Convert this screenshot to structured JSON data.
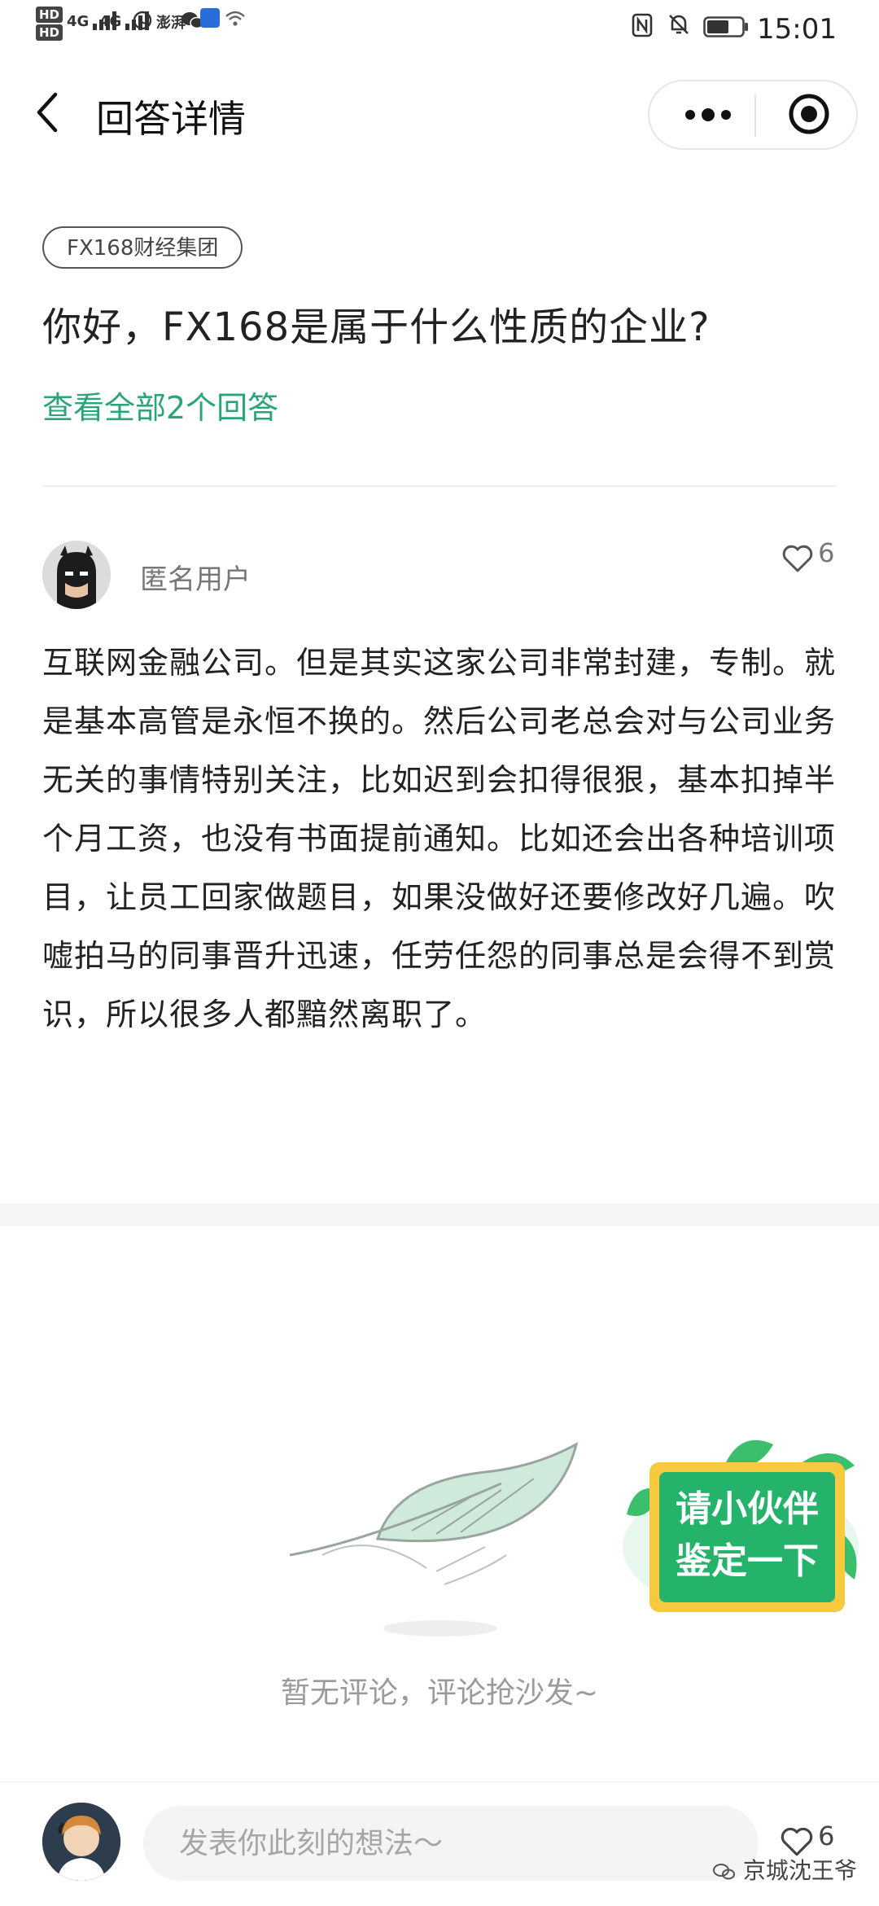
{
  "status_bar": {
    "hd1": "HD",
    "hd2": "HD",
    "sim1": "4G",
    "sim2": "4G",
    "app_icon_1": "澎湃",
    "time": "15:01",
    "icons": [
      "whatsapp-icon",
      "wechat-icon",
      "app-icon",
      "wifi-icon",
      "nfc-icon",
      "mute-icon",
      "battery-icon"
    ]
  },
  "nav": {
    "title": "回答详情",
    "back_icon": "chevron-left-icon",
    "more_icon": "more-dots-icon",
    "close_icon": "target-icon"
  },
  "question": {
    "tag": "FX168财经集团",
    "title": "你好，FX168是属于什么性质的企业?",
    "view_all": "查看全部2个回答"
  },
  "answer": {
    "user": "匿名用户",
    "likes": "6",
    "text": "互联网金融公司。但是其实这家公司非常封建，专制。就是基本高管是永恒不换的。然后公司老总会对与公司业务无关的事情特别关注，比如迟到会扣得很狠，基本扣掉半个月工资，也没有书面提前通知。比如还会出各种培训项目，让员工回家做题目，如果没做好还要修改好几遍。吹嘘拍马的同事晋升迅速，任劳任怨的同事总是会得不到赏识，所以很多人都黯然离职了。"
  },
  "comments": {
    "empty_text": "暂无评论，评论抢沙发~",
    "badge_line1": "请小伙伴",
    "badge_line2": "鉴定一下"
  },
  "bottom": {
    "placeholder": "发表你此刻的想法～",
    "likes": "6",
    "watermark": "京城沈王爷"
  },
  "colors": {
    "accent_green": "#2aa57a",
    "badge_green": "#25b26a",
    "badge_yellow": "#f6c93f"
  }
}
